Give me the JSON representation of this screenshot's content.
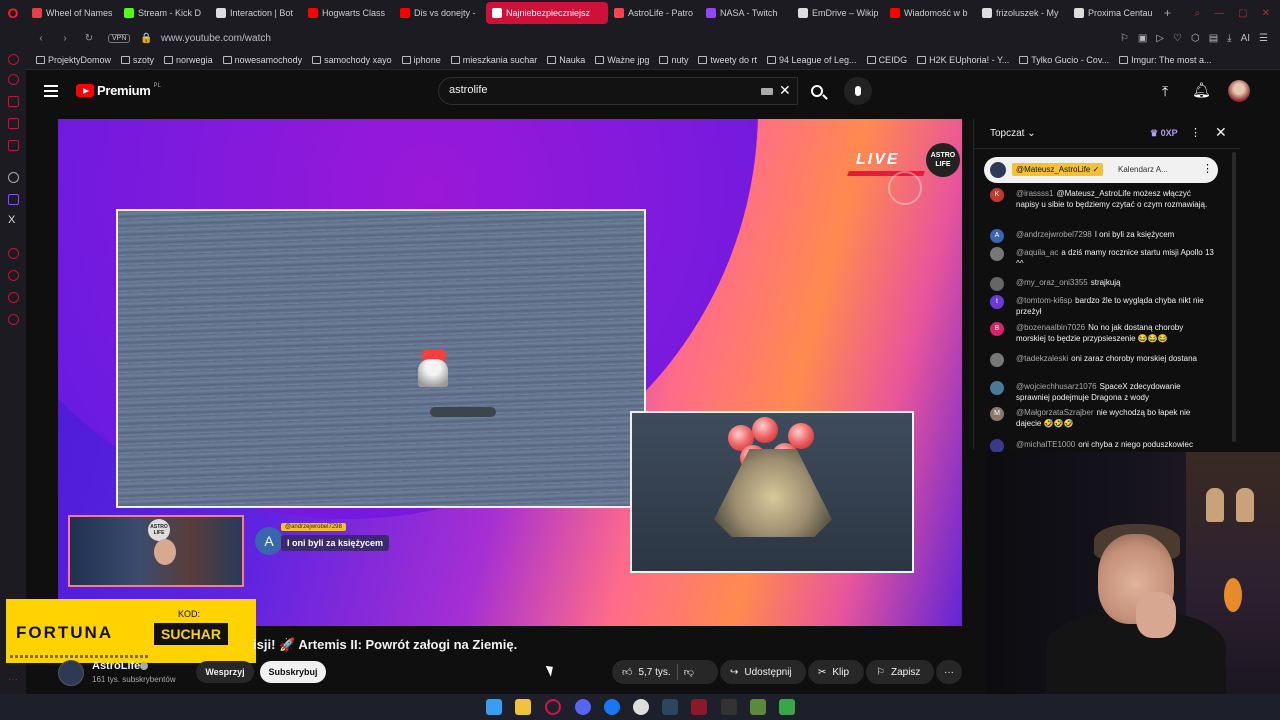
{
  "browser": {
    "tabs": [
      {
        "label": "Wheel of Names",
        "color": "#e4404c"
      },
      {
        "label": "Stream - Kick D",
        "color": "#53fc18"
      },
      {
        "label": "Interaction | Bot",
        "color": "#dddddd"
      },
      {
        "label": "Hogwarts Class",
        "color": "#ff0000"
      },
      {
        "label": "Dis vs donejty -",
        "color": "#ff0000"
      },
      {
        "label": "Najniebezpieczniejsz",
        "color": "#ffffff"
      },
      {
        "label": "AstroLife - Patro",
        "color": "#ff424d"
      },
      {
        "label": "NASA - Twitch",
        "color": "#9146ff"
      },
      {
        "label": "EmDrive – Wikip",
        "color": "#dddddd"
      },
      {
        "label": "Wiadomość w b",
        "color": "#ff0000"
      },
      {
        "label": "frizoluszek - My",
        "color": "#dddddd"
      },
      {
        "label": "Proxima Centau",
        "color": "#dddddd"
      }
    ],
    "active_tab_index": 5,
    "new_tab": "+",
    "vpn": "VPN",
    "url": "www.youtube.com/watch",
    "ai_label": "AI",
    "bookmarks": [
      "ProjektyDomow",
      "szoty",
      "norwegia",
      "nowesamochody",
      "samochody xayo",
      "iphone",
      "mieszkania suchar",
      "Nauka",
      "Ważne jpg",
      "nuty",
      "tweety do rt",
      "94 League of Leg...",
      "CEIDG",
      "H2K EUphoria! - Y...",
      "Tylko Gucio - Cov...",
      "Imgur: The most a..."
    ]
  },
  "youtube": {
    "logo_text": "Premium",
    "region": "PL",
    "search_value": "astrolife"
  },
  "player": {
    "live_text": "LIVE",
    "astro_logo": "ASTRO LIFE",
    "cam_logo": "ASTRO LIFE",
    "bubble_avatar": "A",
    "bubble_user": "@andrzejwrobel7298",
    "bubble_msg": "I oni byli za księżycem"
  },
  "ad": {
    "brand": "FORTUNA",
    "code_label": "KOD:",
    "code": "SUCHAR"
  },
  "video": {
    "title": "isji! 🚀 Artemis II: Powrót załogi na Ziemię.",
    "channel": "AstroLife",
    "subscribers": "161 tys. subskrybentów",
    "support_label": "Wesprzyj",
    "subscribe_label": "Subskrybuj",
    "likes": "5,7 tys.",
    "share_label": "Udostępnij",
    "clip_label": "Klip",
    "save_label": "Zapisz"
  },
  "chat": {
    "title": "Topczat",
    "points": "0XP",
    "pinned_user": "@Mateusz_AstroLife ✓",
    "pinned_msg": "Kalendarz A...",
    "messages": [
      {
        "avatar": "K",
        "color": "#c0392b",
        "user": "@irassss1",
        "text": "@Mateusz_AstroLife możesz włączyć napisy u sibie to będziemy czytać o czym rozmawiają."
      },
      {
        "avatar": "A",
        "color": "#3966ad",
        "user": "@andrzejwrobel7298",
        "text": "I oni byli za księżycem"
      },
      {
        "avatar": "",
        "color": "#777777",
        "user": "@aquila_ac",
        "text": "a dziś mamy rocznice startu misji Apollo 13 ^^"
      },
      {
        "avatar": "",
        "color": "#666666",
        "user": "@my_oraz_oni3355",
        "text": "strajkują"
      },
      {
        "avatar": "t",
        "color": "#6a3ad6",
        "user": "@tomtom-ki6sp",
        "text": "bardzo źle to wygląda chyba nikt nie przeżył"
      },
      {
        "avatar": "B",
        "color": "#d6246a",
        "user": "@bozenaalbin7026",
        "text": "No no jak dostaną choroby morskiej to będzie przypsieszenie 😂😂😂"
      },
      {
        "avatar": "",
        "color": "#777777",
        "user": "@tadekzaleski",
        "text": "oni zaraz choroby morskiej dostana"
      },
      {
        "avatar": "",
        "color": "#4a7a9a",
        "user": "@wojciechhusarz1076",
        "text": "SpaceX zdecydowanie sprawniej podejmuje Dragona z wody"
      },
      {
        "avatar": "M",
        "color": "#8a7a6a",
        "user": "@MałgorzataSzrajber",
        "text": "nie wychodzą bo łapek nie dajecie 🤣🤣🤣"
      },
      {
        "avatar": "",
        "color": "#3a3a8a",
        "user": "@michalTE1000",
        "text": "oni chyba z niego poduszkowiec"
      }
    ]
  }
}
